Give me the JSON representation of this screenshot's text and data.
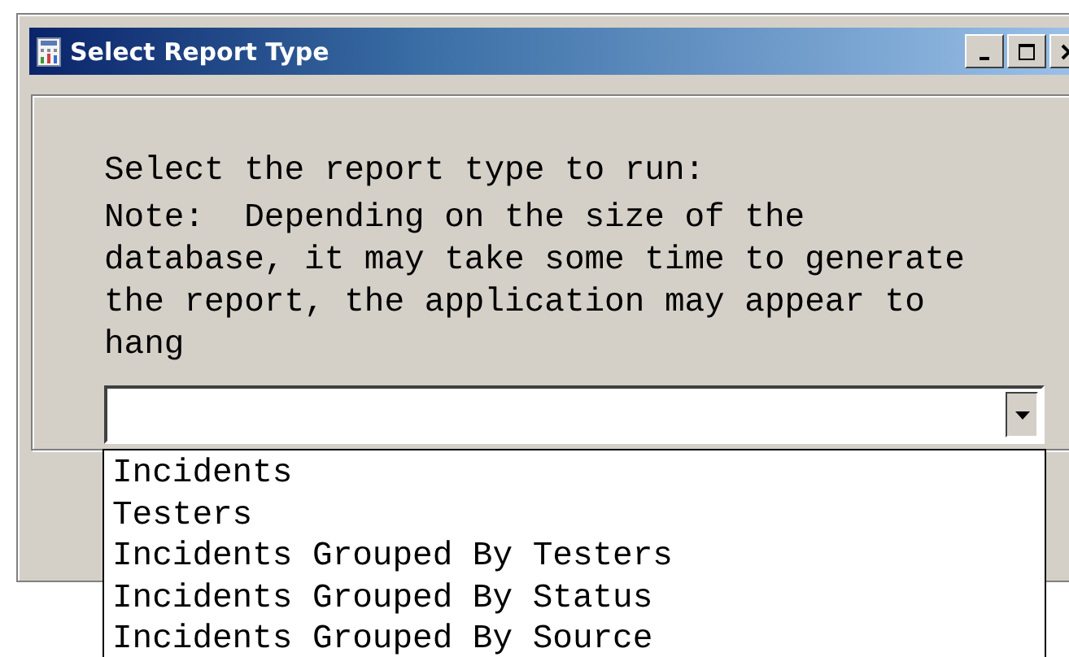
{
  "window": {
    "title": "Select Report Type"
  },
  "prompt": "Select the report type to run:",
  "note": "Note:  Depending on the size of the database, it may take some time to generate the report, the application may appear to hang",
  "report_type_combo": {
    "expanded": true,
    "options": [
      {
        "label": "Incidents",
        "selected": false
      },
      {
        "label": "Testers",
        "selected": false
      },
      {
        "label": "Incidents Grouped By Testers",
        "selected": false
      },
      {
        "label": "Incidents Grouped By Status",
        "selected": false
      },
      {
        "label": "Incidents Grouped By Source",
        "selected": false
      }
    ]
  }
}
